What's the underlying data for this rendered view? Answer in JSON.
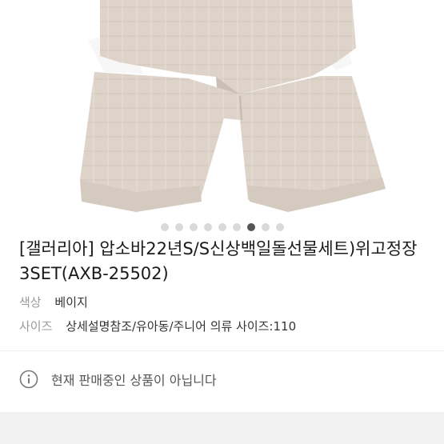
{
  "product": {
    "title": "[갤러리아] 압소바22년S/S신상백일돌선물세트)위고정장3SET(AXB-25502)",
    "color_label": "색상",
    "color_value": "베이지",
    "size_label": "사이즈",
    "size_value": "상세설명참조/유아동/주니어 의류 사이즈:110"
  },
  "carousel": {
    "total": 9,
    "active_index": 6
  },
  "notice": {
    "text": "현재 판매중인 상품이 아닙니다",
    "icon": "info-icon"
  },
  "colors": {
    "accent_dot": "#555555",
    "dot": "#d9d9d9",
    "label": "#9a9a9a"
  }
}
